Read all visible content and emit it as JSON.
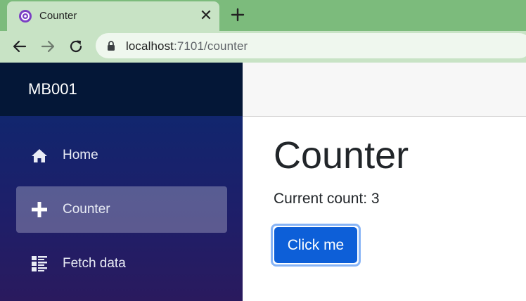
{
  "browser": {
    "tab_title": "Counter",
    "tab_close": "✕",
    "url_host": "localhost",
    "url_rest": ":7101/counter"
  },
  "app": {
    "brand": "MB001"
  },
  "sidebar": {
    "items": [
      {
        "label": "Home",
        "icon": "home-icon"
      },
      {
        "label": "Counter",
        "icon": "plus-icon",
        "active": true
      },
      {
        "label": "Fetch data",
        "icon": "list-icon"
      }
    ]
  },
  "main": {
    "title": "Counter",
    "count_text": "Current count: 3",
    "button_label": "Click me"
  },
  "colors": {
    "primary_button": "#0d5fd8",
    "sidebar_top": "#041737",
    "tab_strip": "#7cbb7c"
  }
}
